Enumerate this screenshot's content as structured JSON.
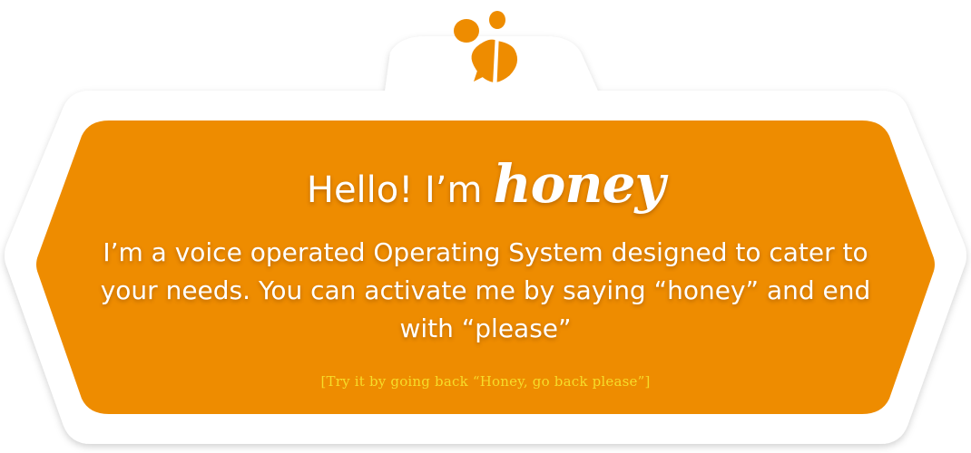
{
  "colors": {
    "panel": "#ee8c00",
    "outline": "#ffffff",
    "bee": "#ee8c00",
    "text": "#ffffff",
    "hint": "#f6dc2a"
  },
  "logo": {
    "icon": "bee-icon"
  },
  "greeting": {
    "prefix": "Hello! I’m",
    "name": "honey"
  },
  "description": "I’m a voice operated Operating System designed to cater to your needs. You can activate me by saying “honey” and end with “please”",
  "hint": "[Try it by going back “Honey, go back please”]"
}
